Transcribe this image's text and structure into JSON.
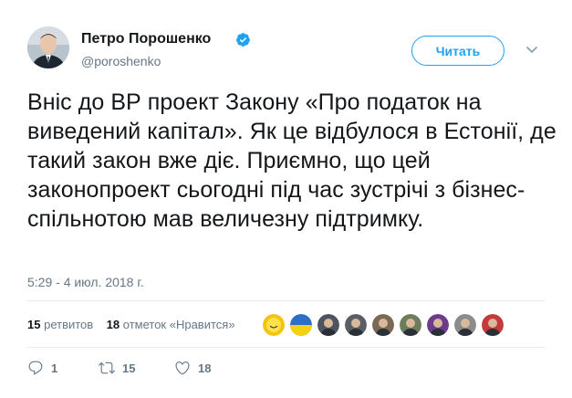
{
  "author": {
    "name": "Петро Порошенко",
    "handle": "@poroshenko",
    "verified": true
  },
  "follow_button": {
    "label": "Читать"
  },
  "tweet": {
    "text": "Вніс до ВР проект Закону «Про податок на виведений капітал». Як це відбулося в Естонії, де такий закон вже діє. Приємно, що цей законопроект сьогодні під час зустрічі з бізнес-спільнотою мав величезну підтримку.",
    "timestamp": "5:29 - 4 июл. 2018 г."
  },
  "stats": {
    "retweets_count": "15",
    "retweets_label": "ретвитов",
    "likes_count": "18",
    "likes_label": "отметок «Нравится»"
  },
  "likers": [
    {
      "icon": "smiley-avatar",
      "color": "#f2c40f"
    },
    {
      "icon": "flag-avatar",
      "color": "#2d6fc4"
    },
    {
      "icon": "person-avatar",
      "color": "#4d5560"
    },
    {
      "icon": "person-avatar",
      "color": "#5a5f66"
    },
    {
      "icon": "person-avatar",
      "color": "#7a6a55"
    },
    {
      "icon": "person-avatar",
      "color": "#6b7d5a"
    },
    {
      "icon": "flower-avatar",
      "color": "#6d3d8c"
    },
    {
      "icon": "cat-avatar",
      "color": "#8c8c8c"
    },
    {
      "icon": "bird-avatar",
      "color": "#c43b3b"
    }
  ],
  "actions": {
    "reply_count": "1",
    "retweet_count": "15",
    "like_count": "18"
  },
  "colors": {
    "accent": "#1da1f2",
    "text": "#14171a",
    "muted": "#657786",
    "verified": "#1da1f2"
  }
}
